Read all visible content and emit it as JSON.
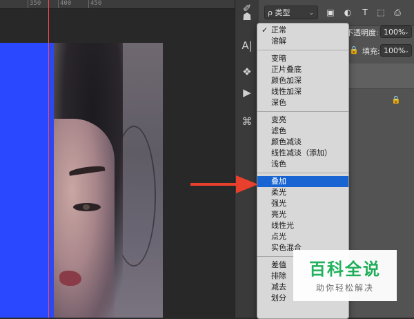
{
  "ruler": {
    "ticks": [
      "350",
      "400",
      "450"
    ]
  },
  "toolbar": {
    "tools": [
      {
        "icon": "brush-icon",
        "glyph": "✐"
      },
      {
        "icon": "stamp-icon",
        "glyph": "☗"
      },
      {
        "icon": "text-direction-icon",
        "glyph": "A|"
      },
      {
        "icon": "layers-3d-icon",
        "glyph": "❖"
      },
      {
        "icon": "play-icon",
        "glyph": "▶"
      },
      {
        "icon": "crop-icon",
        "glyph": "⌘"
      }
    ]
  },
  "layers_panel": {
    "kind_filter": "ρ 类型",
    "opacity_label": "不透明度:",
    "opacity_value": "100%",
    "fill_label": "填充:",
    "fill_value": "100%"
  },
  "blend_menu": {
    "groups": [
      [
        "正常",
        "溶解"
      ],
      [
        "变暗",
        "正片叠底",
        "颜色加深",
        "线性加深",
        "深色"
      ],
      [
        "变亮",
        "滤色",
        "颜色减淡",
        "线性减淡（添加）",
        "浅色"
      ],
      [
        "叠加",
        "柔光",
        "强光",
        "亮光",
        "线性光",
        "点光",
        "实色混合"
      ],
      [
        "差值",
        "排除",
        "减去",
        "划分"
      ]
    ],
    "checked": "正常",
    "highlighted": "叠加"
  },
  "watermark": {
    "title": "百科全说",
    "subtitle": "助你轻松解决"
  },
  "colors": {
    "canvas_blue": "#2a48ff",
    "menu_highlight": "#1764d2",
    "annotation_arrow": "#e8402c",
    "watermark_green": "#1db15a"
  }
}
